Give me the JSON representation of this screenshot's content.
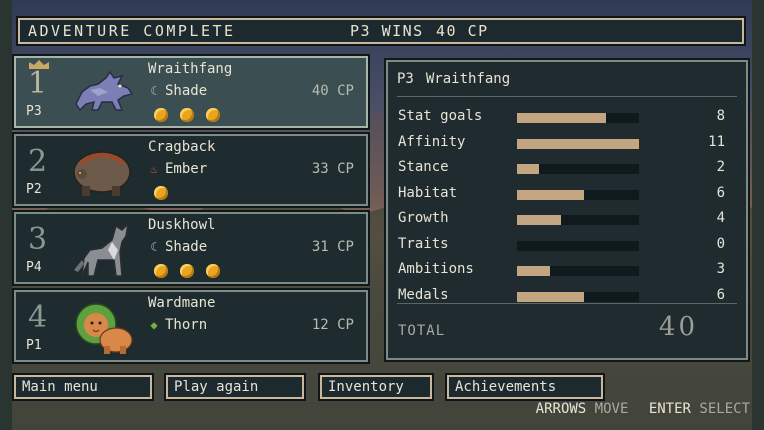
{
  "header": {
    "title": "ADVENTURE COMPLETE",
    "winner": "P3 WINS",
    "cp": "40 CP"
  },
  "results": [
    {
      "rank": "1",
      "player": "P3",
      "name": "Wraithfang",
      "element": "Shade",
      "element_icon": "crescent-moon-icon",
      "cp": "40 CP",
      "medals": 3,
      "selected": true
    },
    {
      "rank": "2",
      "player": "P2",
      "name": "Cragback",
      "element": "Ember",
      "element_icon": "flame-icon",
      "cp": "33 CP",
      "medals": 1,
      "selected": false
    },
    {
      "rank": "3",
      "player": "P4",
      "name": "Duskhowl",
      "element": "Shade",
      "element_icon": "crescent-moon-icon",
      "cp": "31 CP",
      "medals": 3,
      "selected": false
    },
    {
      "rank": "4",
      "player": "P1",
      "name": "Wardmane",
      "element": "Thorn",
      "element_icon": "leaf-icon",
      "cp": "12 CP",
      "medals": 0,
      "selected": false
    }
  ],
  "detail": {
    "player": "P3",
    "name": "Wraithfang",
    "stats": [
      {
        "label": "Stat goals",
        "value": "8",
        "fill": 0.73
      },
      {
        "label": "Affinity",
        "value": "11",
        "fill": 1.0
      },
      {
        "label": "Stance",
        "value": "2",
        "fill": 0.18
      },
      {
        "label": "Habitat",
        "value": "6",
        "fill": 0.55
      },
      {
        "label": "Growth",
        "value": "4",
        "fill": 0.36
      },
      {
        "label": "Traits",
        "value": "0",
        "fill": 0.0
      },
      {
        "label": "Ambitions",
        "value": "3",
        "fill": 0.27
      },
      {
        "label": "Medals",
        "value": "6",
        "fill": 0.55
      }
    ],
    "total_label": "TOTAL",
    "total_value": "40"
  },
  "buttons": {
    "main_menu": "Main menu",
    "play_again": "Play again",
    "inventory": "Inventory",
    "achievements": "Achievements"
  },
  "hints": {
    "key1": "ARROWS",
    "action1": "MOVE",
    "key2": "ENTER",
    "action2": "SELECT"
  },
  "colors": {
    "panel_bg": "#1f2b2f",
    "stat_fill": "#c4a582",
    "medal": "#e9a520",
    "frame": "#c9b99a"
  }
}
